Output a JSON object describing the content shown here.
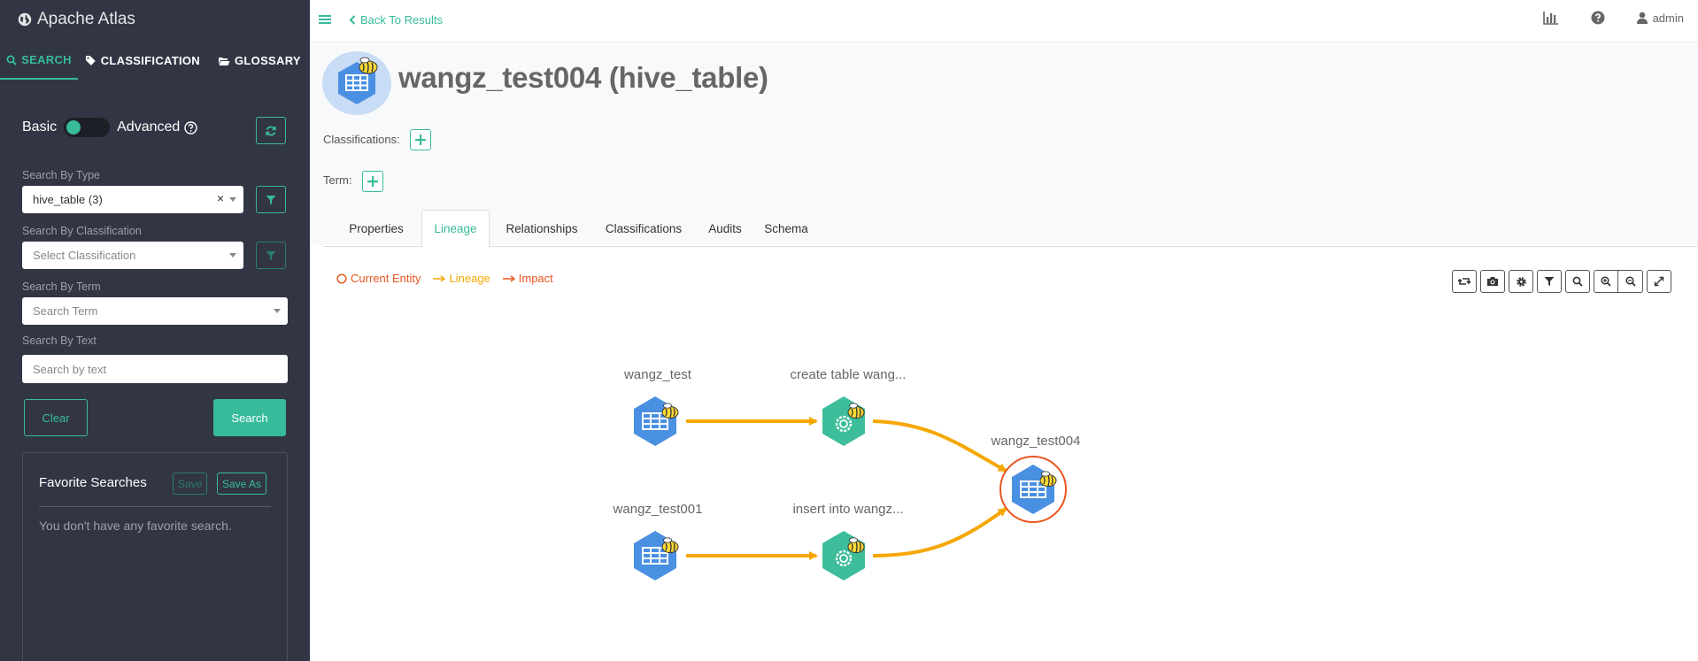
{
  "app": {
    "title": "Apache Atlas"
  },
  "sidebar": {
    "tabs": [
      {
        "label": "SEARCH",
        "icon": "search-icon"
      },
      {
        "label": "CLASSIFICATION",
        "icon": "tag-icon"
      },
      {
        "label": "GLOSSARY",
        "icon": "folder-open-icon"
      }
    ],
    "toggle": {
      "left": "Basic",
      "right": "Advanced"
    },
    "type": {
      "label": "Search By Type",
      "value": "hive_table (3)"
    },
    "classification": {
      "label": "Search By Classification",
      "placeholder": "Select Classification"
    },
    "term": {
      "label": "Search By Term",
      "placeholder": "Search Term"
    },
    "text": {
      "label": "Search By Text",
      "placeholder": "Search by text"
    },
    "clear_label": "Clear",
    "search_label": "Search",
    "favorites": {
      "title": "Favorite Searches",
      "save_label": "Save",
      "save_as_label": "Save As",
      "empty": "You don't have any favorite search."
    }
  },
  "header": {
    "back_label": "Back To Results",
    "user": "admin"
  },
  "entity": {
    "title": "wangz_test004 (hive_table)",
    "classifications_label": "Classifications:",
    "term_label": "Term:"
  },
  "tabs": [
    "Properties",
    "Lineage",
    "Relationships",
    "Classifications",
    "Audits",
    "Schema"
  ],
  "legend": {
    "current": "Current Entity",
    "lineage": "Lineage",
    "impact": "Impact"
  },
  "lineage": {
    "nodes": [
      {
        "label": "wangz_test",
        "kind": "table"
      },
      {
        "label": "create table wang...",
        "kind": "process"
      },
      {
        "label": "wangz_test001",
        "kind": "table"
      },
      {
        "label": "insert into wangz...",
        "kind": "process"
      },
      {
        "label": "wangz_test004",
        "kind": "table",
        "current": true
      }
    ]
  },
  "colors": {
    "sidebar_bg": "#323544",
    "accent": "#37bb9b",
    "lineage_edge": "#f5a700",
    "impact": "#e8561f",
    "table_node": "#4a90e2",
    "process_node": "#3dbd9a"
  }
}
